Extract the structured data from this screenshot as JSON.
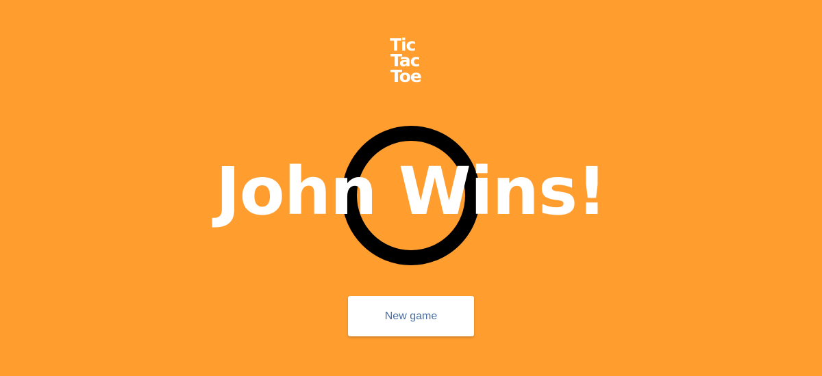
{
  "logo": {
    "line1": "Tic",
    "line2": "Tac",
    "line3": "Toe"
  },
  "game": {
    "winner_message": "John Wins!",
    "winning_mark": "O",
    "mark_icon": "o-mark-icon"
  },
  "actions": {
    "new_game_label": "New game"
  },
  "colors": {
    "background": "#ff9d2f",
    "text": "#ffffff",
    "mark": "#000000",
    "button_text": "#4a6fa5"
  }
}
